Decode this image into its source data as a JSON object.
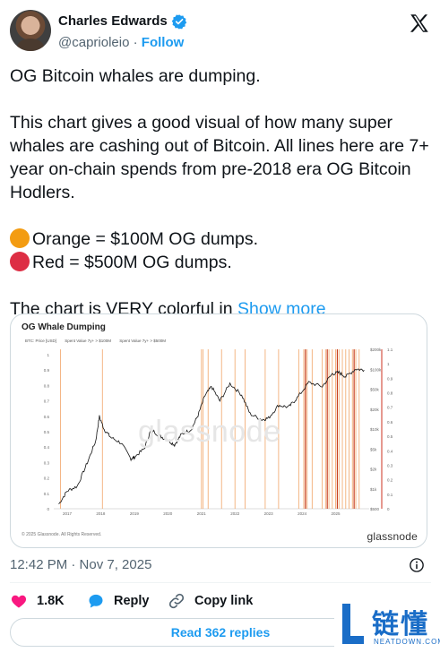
{
  "author": {
    "name": "Charles Edwards",
    "handle": "@caprioleio",
    "separator": "·",
    "follow_label": "Follow"
  },
  "tweet": {
    "line1": "OG Bitcoin whales are dumping.",
    "para2": "This chart gives a good visual of how many super whales are cashing out of Bitcoin. All lines here are 7+ year on-chain spends from pre-2018 era OG Bitcoin Hodlers.",
    "orange_line": "Orange = $100M OG dumps.",
    "red_line": "Red = $500M OG dumps.",
    "teaser": "The chart is VERY colorful in",
    "show_more": "Show more"
  },
  "chart_card": {
    "watermark": "glassnode",
    "copyright": "© 2025 Glassnode. All Rights Reserved.",
    "brand": "glassnode"
  },
  "chart_data": {
    "type": "line",
    "title": "OG Whale Dumping",
    "legend": [
      "BTC: Price [USD]",
      "Spent Value 7y+ > $100M",
      "Spent Value 7y+ > $500M"
    ],
    "x_ticks": [
      "2017",
      "2018",
      "2019",
      "2020",
      "2021",
      "2022",
      "2023",
      "2024",
      "2025"
    ],
    "left_axis_ticks": [
      "1",
      "0.9",
      "0.8",
      "0.7",
      "0.6",
      "0.5",
      "0.4",
      "0.3",
      "0.2",
      "0.1",
      "0"
    ],
    "right_axis_price_ticks": [
      "$200k",
      "$100k",
      "$50k",
      "$20k",
      "$10k",
      "$5k",
      "$2k",
      "$1k",
      "$500"
    ],
    "right_axis_value_ticks": [
      "1.1",
      "1",
      "0.9",
      "0.8",
      "0.7",
      "0.6",
      "0.5",
      "0.4",
      "0.3",
      "0.2",
      "0.1",
      "0"
    ],
    "series": [
      {
        "name": "BTC: Price [USD]",
        "x": [
          2016.75,
          2017.0,
          2017.3,
          2017.6,
          2017.85,
          2017.96,
          2018.1,
          2018.3,
          2018.6,
          2018.9,
          2019.0,
          2019.3,
          2019.5,
          2019.75,
          2020.0,
          2020.2,
          2020.4,
          2020.7,
          2020.9,
          2021.1,
          2021.3,
          2021.55,
          2021.85,
          2022.2,
          2022.45,
          2022.8,
          2023.0,
          2023.3,
          2023.6,
          2023.85,
          2024.2,
          2024.6,
          2024.9,
          2025.1,
          2025.3,
          2025.6,
          2025.85
        ],
        "y": [
          600,
          1000,
          1200,
          3000,
          7000,
          18000,
          11000,
          8000,
          6500,
          3500,
          3700,
          5200,
          11000,
          8500,
          7200,
          6000,
          9000,
          11000,
          19000,
          40000,
          58000,
          33000,
          65000,
          42000,
          20000,
          16000,
          17000,
          28000,
          26000,
          37000,
          68000,
          58000,
          95000,
          100000,
          85000,
          115000,
          110000
        ]
      }
    ],
    "spend_events_100m": [
      2016.8,
      2018.05,
      2021.0,
      2021.05,
      2021.2,
      2021.6,
      2022.0,
      2022.3,
      2022.9,
      2023.3,
      2023.9,
      2024.05,
      2024.1,
      2024.15,
      2024.3,
      2024.6,
      2024.7,
      2024.8,
      2024.9,
      2025.0,
      2025.1,
      2025.2,
      2025.3,
      2025.4,
      2025.5,
      2025.6,
      2025.7
    ],
    "spend_events_500m": [
      2024.1,
      2024.75,
      2025.05,
      2025.55
    ],
    "price_scale": "log",
    "colors": {
      "price": "#111111",
      "orange": "#f0a060",
      "red": "#c84020",
      "axis_red": "#cc3322"
    }
  },
  "timestamp": "12:42 PM · Nov 7, 2025",
  "actions": {
    "likes": "1.8K",
    "reply_label": "Reply",
    "copy_link_label": "Copy link"
  },
  "read_replies_label": "Read 362 replies",
  "overlay": {
    "cn_text": "链懂",
    "en_text": "NEATDOWN.COM"
  },
  "colors": {
    "accent": "#1d9bf0",
    "like": "#f91880",
    "orange_dot": "#f39c12",
    "red_dot": "#dd2e44",
    "text_secondary": "#536471"
  }
}
